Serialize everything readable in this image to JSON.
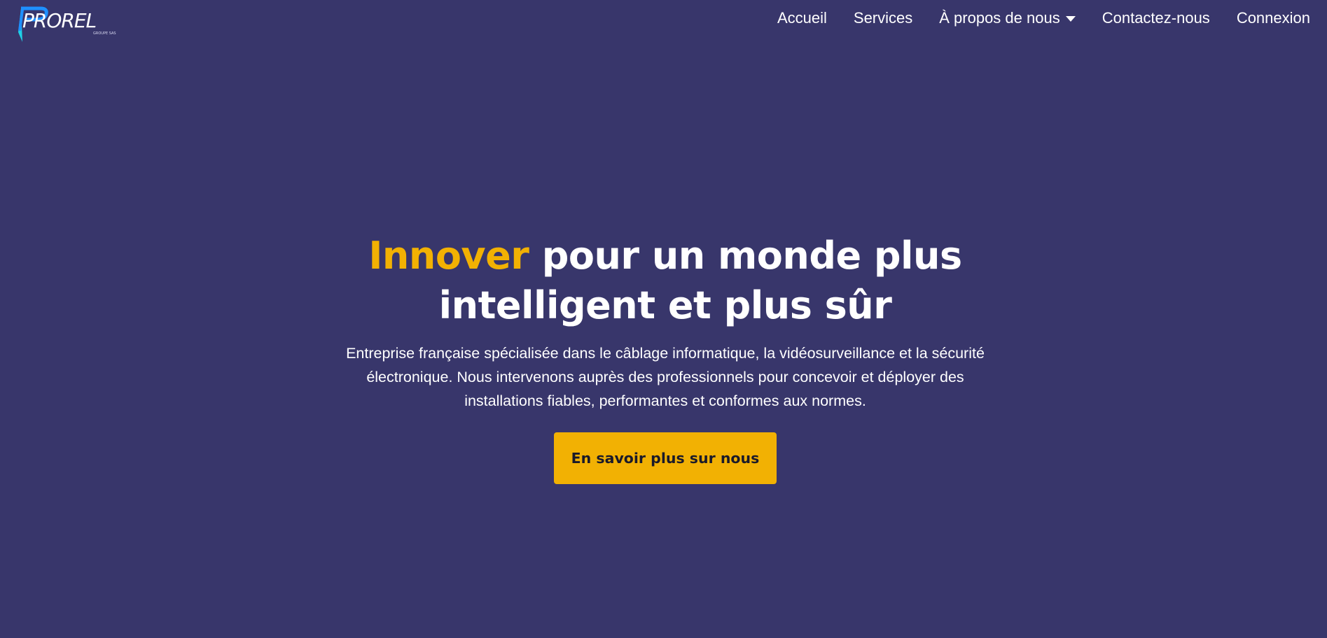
{
  "logo": {
    "text": "PROREL",
    "subtext": "GROUPE SAS",
    "icon": "prorel-logo-icon"
  },
  "nav": {
    "items": [
      {
        "label": "Accueil"
      },
      {
        "label": "Services"
      },
      {
        "label": "À propos de nous",
        "icon": "caret-down-icon"
      },
      {
        "label": "Contactez-nous"
      },
      {
        "label": "Connexion"
      }
    ]
  },
  "hero": {
    "title_accent": "Innover",
    "title_line1_rest": " pour un monde plus",
    "title_line2": "intelligent et plus sûr",
    "description": "Entreprise française spécialisée dans le câblage informatique, la vidéosurveillance et la sécurité électronique. Nous intervenons auprès des professionnels pour concevoir et déployer des installations fiables, performantes et conformes aux normes.",
    "cta_label": "En savoir plus sur nous"
  },
  "colors": {
    "background": "#38366b",
    "accent": "#f2b103",
    "text": "#ffffff",
    "logo_blue": "#1e90ff",
    "logo_cyan": "#1fd1e6"
  }
}
